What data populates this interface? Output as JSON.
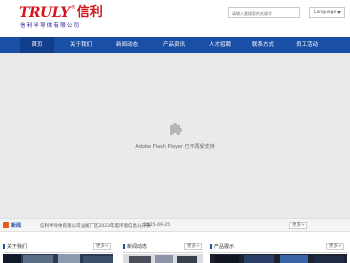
{
  "header": {
    "logo_latin": "TRULY",
    "logo_reg": "®",
    "logo_cn": "信利",
    "logo_sub": "信利半导体有限公司",
    "search_placeholder": "请输入要搜索的关键字",
    "language": "Language"
  },
  "nav": {
    "items": [
      {
        "label": "首页"
      },
      {
        "label": "关于我们"
      },
      {
        "label": "新闻动态"
      },
      {
        "label": "产品资讯"
      },
      {
        "label": "人才招聘"
      },
      {
        "label": "联系方式"
      },
      {
        "label": "员工活动"
      }
    ]
  },
  "flash": {
    "message": "Adobe Flash Player 已不再受支持"
  },
  "news": {
    "label": "新闻",
    "headline": "信利半导体有限公司汕尾厂区2023年度环境信息公开表",
    "date": "2025-09-25",
    "more": "更多>"
  },
  "sections": [
    {
      "title": "关于我们",
      "more": "更多>"
    },
    {
      "title": "新闻动态",
      "more": "更多>"
    },
    {
      "title": "产品展示",
      "more": "更多>"
    }
  ],
  "colors": {
    "nav_bg": "#1a4fa6",
    "brand_red": "#d8121a"
  }
}
